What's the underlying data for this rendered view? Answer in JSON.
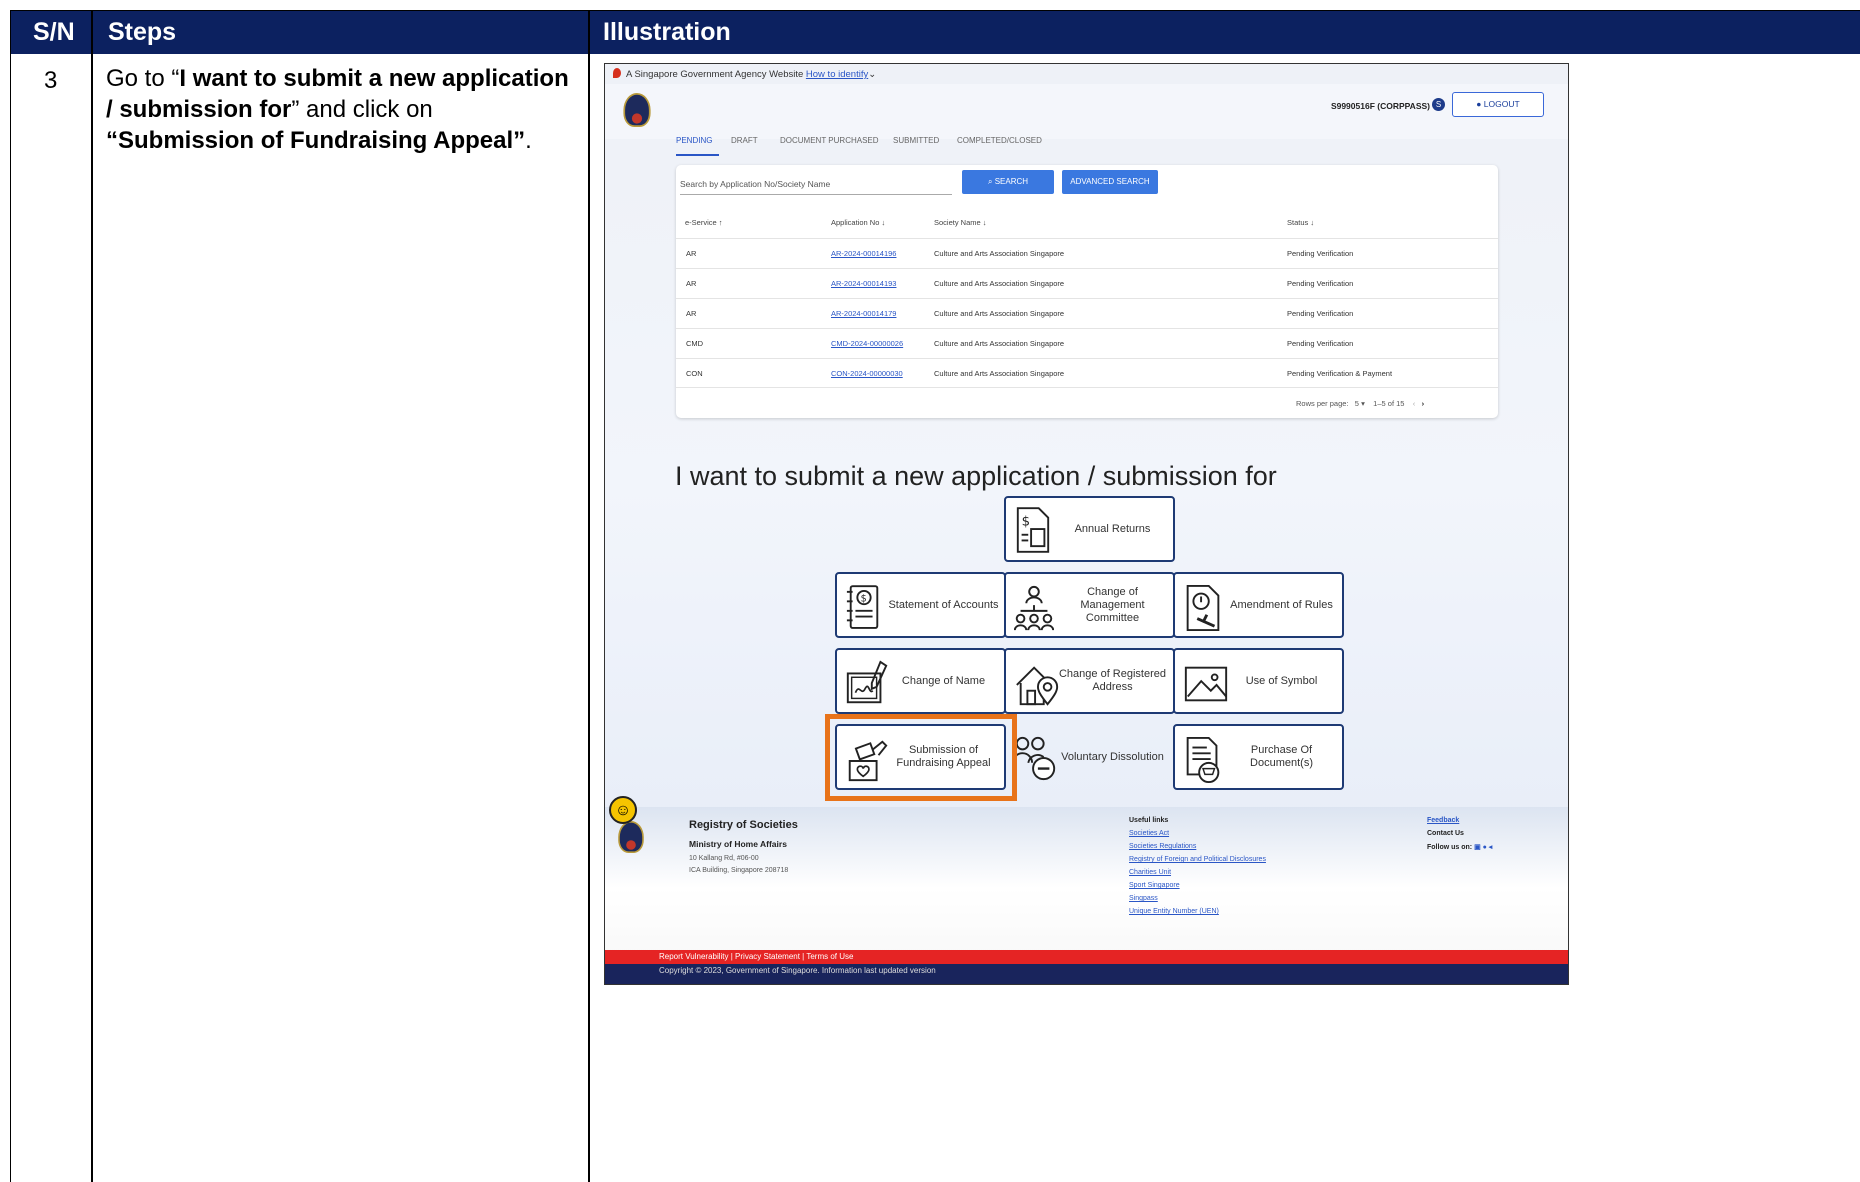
{
  "table": {
    "header": {
      "sn": "S/N",
      "steps": "Steps",
      "illustration": "Illustration"
    },
    "row": {
      "sn": "3",
      "step_text_1": "Go to “",
      "step_bold_1": "I want to submit a new application / submission for",
      "step_text_2": "” and click on ",
      "step_bold_2": "“Submission of Fundraising Appeal”",
      "step_text_3": "."
    }
  },
  "screenshot": {
    "gov_banner": {
      "text": "A Singapore Government Agency Website",
      "link": "How to identify"
    },
    "user": {
      "id": "S9990516F (CORPPASS)",
      "badge": "S",
      "logout_label": "LOGOUT"
    },
    "tabs": [
      "PENDING",
      "DRAFT",
      "DOCUMENT PURCHASED",
      "SUBMITTED",
      "COMPLETED/CLOSED"
    ],
    "active_tab": "PENDING",
    "search": {
      "placeholder": "Search by Application No/Society Name",
      "search_label": "SEARCH",
      "advanced_label": "ADVANCED SEARCH"
    },
    "columns": [
      "e-Service ↑",
      "Application No ↓",
      "Society Name ↓",
      "Status ↓"
    ],
    "rows": [
      {
        "eservice": "AR",
        "app_no": "AR-2024-00014196",
        "society": "Culture and Arts Association Singapore",
        "status": "Pending Verification"
      },
      {
        "eservice": "AR",
        "app_no": "AR-2024-00014193",
        "society": "Culture and Arts Association Singapore",
        "status": "Pending Verification"
      },
      {
        "eservice": "AR",
        "app_no": "AR-2024-00014179",
        "society": "Culture and Arts Association Singapore",
        "status": "Pending Verification"
      },
      {
        "eservice": "CMD",
        "app_no": "CMD-2024-00000026",
        "society": "Culture and Arts Association Singapore",
        "status": "Pending Verification"
      },
      {
        "eservice": "CON",
        "app_no": "CON-2024-00000030",
        "society": "Culture and Arts Association Singapore",
        "status": "Pending Verification & Payment"
      }
    ],
    "pager": {
      "rows_per_page_label": "Rows per page:",
      "rows_per_page": "5",
      "range": "1–5 of 15"
    },
    "heading": "I want to submit a new application / submission for",
    "tiles": {
      "annual_returns": "Annual Returns",
      "statement_of_accounts": "Statement of Accounts",
      "change_of_management": "Change of Management Committee",
      "amendment_of_rules": "Amendment of Rules",
      "change_of_name": "Change of Name",
      "change_of_address": "Change of Registered Address",
      "use_of_symbol": "Use of Symbol",
      "fundraising": "Submission of Fundraising Appeal",
      "voluntary_dissolution": "Voluntary Dissolution",
      "purchase_documents": "Purchase Of Document(s)"
    },
    "highlight_color": "#e8731a",
    "footer": {
      "org": "Registry of Societies",
      "ministry": "Ministry of Home Affairs",
      "address_1": "10 Kallang Rd, #06-00",
      "address_2": "ICA Building, Singapore 208718",
      "useful_links_title": "Useful links",
      "links": [
        "Societies Act",
        "Societies Regulations",
        "Registry of Foreign and Political Disclosures",
        "Charities Unit",
        "Sport Singapore",
        "Singpass",
        "Unique Entity Number (UEN)"
      ],
      "feedback": "Feedback",
      "contact": "Contact Us",
      "follow": "Follow us on:",
      "legal": "Report Vulnerability | Privacy Statement | Terms of Use",
      "copyright": "Copyright © 2023, Government of Singapore. Information last updated version"
    }
  }
}
